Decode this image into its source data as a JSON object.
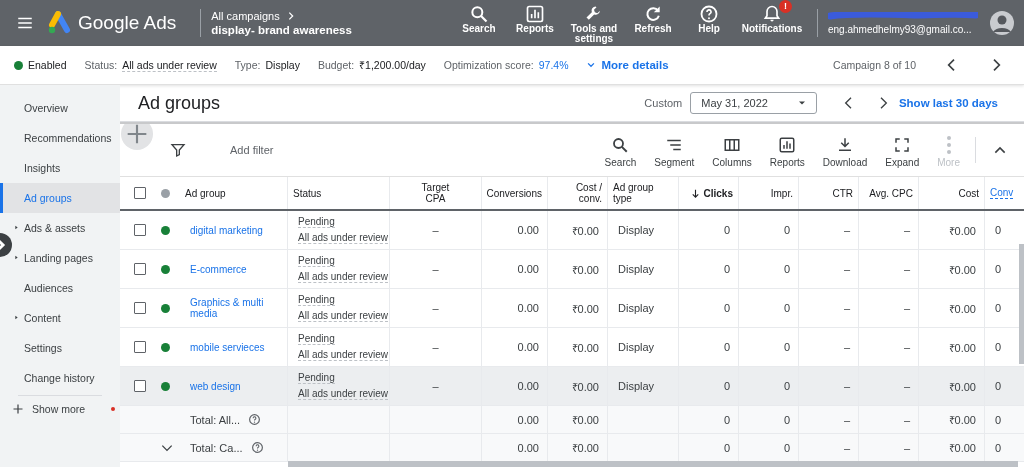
{
  "header": {
    "product": "Google Ads",
    "breadcrumb": "All campaigns",
    "campaign": "display- brand awareness",
    "actions": [
      {
        "kind": "search",
        "label": "Search"
      },
      {
        "kind": "reports",
        "label": "Reports"
      },
      {
        "kind": "tools",
        "label": "Tools and settings"
      },
      {
        "kind": "refresh",
        "label": "Refresh"
      },
      {
        "kind": "help",
        "label": "Help"
      },
      {
        "kind": "notifications",
        "label": "Notifications",
        "badge": "!"
      }
    ],
    "account": "eng.ahmedhelmy93@gmail.co..."
  },
  "campaign_bar": {
    "enabled": true,
    "status_text": "Enabled",
    "status_label": "Status:",
    "status_value": "All ads under review",
    "type_label": "Type:",
    "type_value": "Display",
    "budget_label": "Budget:",
    "budget_value": "₹1,200.00/day",
    "optimization_label": "Optimization score:",
    "optimization_value": "97.4%",
    "more_details": "More details",
    "position": "Campaign 8 of 10"
  },
  "sidebar": {
    "items": [
      {
        "label": "Overview",
        "selected": false,
        "expandable": false
      },
      {
        "label": "Recommendations",
        "selected": false,
        "expandable": false
      },
      {
        "label": "Insights",
        "selected": false,
        "expandable": false
      },
      {
        "label": "Ad groups",
        "selected": true,
        "expandable": false
      },
      {
        "label": "Ads & assets",
        "selected": false,
        "expandable": true
      },
      {
        "label": "Landing pages",
        "selected": false,
        "expandable": true
      },
      {
        "label": "Audiences",
        "selected": false,
        "expandable": false
      },
      {
        "label": "Content",
        "selected": false,
        "expandable": true
      },
      {
        "label": "Settings",
        "selected": false,
        "expandable": false
      },
      {
        "label": "Change history",
        "selected": false,
        "expandable": false
      }
    ],
    "show_more": {
      "label": "Show more",
      "has_update": true
    }
  },
  "page": {
    "title": "Ad groups",
    "date_label": "Custom",
    "date": "May 31, 2022",
    "show_last": "Show last 30 days"
  },
  "toolbar": {
    "add_filter": "Add filter",
    "actions": [
      {
        "kind": "search",
        "label": "Search",
        "disabled": false
      },
      {
        "kind": "segment",
        "label": "Segment",
        "disabled": false
      },
      {
        "kind": "columns",
        "label": "Columns",
        "disabled": false
      },
      {
        "kind": "reports",
        "label": "Reports",
        "disabled": false
      },
      {
        "kind": "download",
        "label": "Download",
        "disabled": false
      },
      {
        "kind": "expand",
        "label": "Expand",
        "disabled": false
      },
      {
        "kind": "more",
        "label": "More",
        "disabled": true
      }
    ]
  },
  "table": {
    "all_selected": false,
    "columns": [
      {
        "label": "Ad group",
        "sorted": false
      },
      {
        "label": "Status",
        "sorted": false
      },
      {
        "label": "Target CPA",
        "sorted": false
      },
      {
        "label": "Conversions",
        "sorted": false
      },
      {
        "label": "Cost / conv.",
        "sorted": false
      },
      {
        "label": "Ad group type",
        "sorted": false
      },
      {
        "label": "Clicks",
        "sorted": true
      },
      {
        "label": "Impr.",
        "sorted": false
      },
      {
        "label": "CTR",
        "sorted": false
      },
      {
        "label": "Avg. CPC",
        "sorted": false
      },
      {
        "label": "Cost",
        "sorted": false
      },
      {
        "label": "Conv",
        "sorted": false
      }
    ],
    "rows": [
      {
        "selected": false,
        "enabled": true,
        "highlighted": false,
        "name": "digital marketing",
        "status": "Pending",
        "status_detail": "All ads under review",
        "target_cpa": "–",
        "conversions": "0.00",
        "cost_conv": "₹0.00",
        "type": "Display",
        "clicks": "0",
        "impr": "0",
        "ctr": "–",
        "avg_cpc": "–",
        "cost": "₹0.00",
        "column_13": "0"
      },
      {
        "selected": false,
        "enabled": true,
        "highlighted": false,
        "name": "E-commerce",
        "status": "Pending",
        "status_detail": "All ads under review",
        "target_cpa": "–",
        "conversions": "0.00",
        "cost_conv": "₹0.00",
        "type": "Display",
        "clicks": "0",
        "impr": "0",
        "ctr": "–",
        "avg_cpc": "–",
        "cost": "₹0.00",
        "column_13": "0"
      },
      {
        "selected": false,
        "enabled": true,
        "highlighted": false,
        "name": "Graphics & multi media",
        "status": "Pending",
        "status_detail": "All ads under review",
        "target_cpa": "–",
        "conversions": "0.00",
        "cost_conv": "₹0.00",
        "type": "Display",
        "clicks": "0",
        "impr": "0",
        "ctr": "–",
        "avg_cpc": "–",
        "cost": "₹0.00",
        "column_13": "0"
      },
      {
        "selected": false,
        "enabled": true,
        "highlighted": false,
        "name": "mobile servieces",
        "status": "Pending",
        "status_detail": "All ads under review",
        "target_cpa": "–",
        "conversions": "0.00",
        "cost_conv": "₹0.00",
        "type": "Display",
        "clicks": "0",
        "impr": "0",
        "ctr": "–",
        "avg_cpc": "–",
        "cost": "₹0.00",
        "column_13": "0"
      },
      {
        "selected": false,
        "enabled": true,
        "highlighted": true,
        "name": "web design",
        "status": "Pending",
        "status_detail": "All ads under review",
        "target_cpa": "–",
        "conversions": "0.00",
        "cost_conv": "₹0.00",
        "type": "Display",
        "clicks": "0",
        "impr": "0",
        "ctr": "–",
        "avg_cpc": "–",
        "cost": "₹0.00",
        "column_13": "0"
      }
    ],
    "totals": [
      {
        "label": "Total: All...",
        "has_toggle": false,
        "conversions": "0.00",
        "cost_conv": "₹0.00",
        "clicks": "0",
        "impr": "0",
        "ctr": "–",
        "avg_cpc": "–",
        "cost": "₹0.00",
        "column_13": "0"
      },
      {
        "label": "Total: Ca...",
        "has_toggle": true,
        "conversions": "0.00",
        "cost_conv": "₹0.00",
        "clicks": "0",
        "impr": "0",
        "ctr": "–",
        "avg_cpc": "–",
        "cost": "₹0.00",
        "column_13": "0"
      }
    ]
  }
}
